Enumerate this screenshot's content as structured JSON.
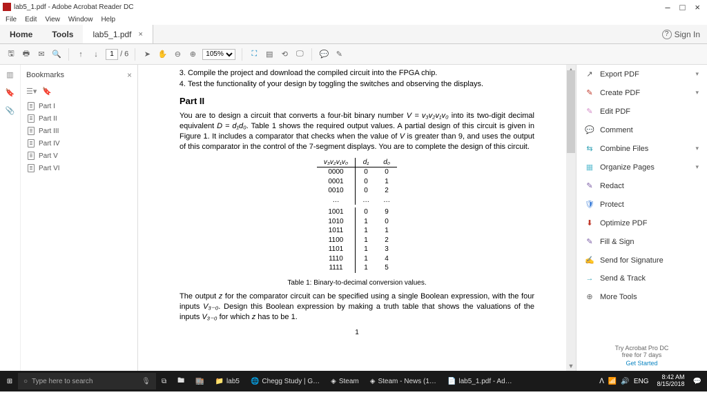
{
  "window": {
    "title": "lab5_1.pdf - Adobe Acrobat Reader DC",
    "min": "–",
    "max": "□",
    "close": "×"
  },
  "menu": [
    "File",
    "Edit",
    "View",
    "Window",
    "Help"
  ],
  "tabs": {
    "home": "Home",
    "tools": "Tools",
    "doc": "lab5_1.pdf",
    "signin": "Sign In",
    "help": "?"
  },
  "toolbar": {
    "page_cur": "1",
    "page_total": "/ 6",
    "zoom": "105%"
  },
  "bookmarks": {
    "title": "Bookmarks",
    "items": [
      "Part I",
      "Part II",
      "Part III",
      "Part IV",
      "Part V",
      "Part VI"
    ]
  },
  "doc": {
    "li3": "Compile the project and download the compiled circuit into the FPGA chip.",
    "li4": "Test the functionality of your design by toggling the switches and observing the displays.",
    "h": "Part II",
    "p1a": "You are to design a circuit that converts a four-bit binary number ",
    "p1b": " into its two-digit decimal equivalent ",
    "p1c": ". Table 1 shows the required output values. A partial design of this circuit is given in Figure 1. It includes a comparator that checks when the value of ",
    "p1d": " is greater than 9, and uses the output of this comparator in the control of the 7-segment displays. You are to complete the design of this circuit.",
    "th_v": "v₃v₂v₁v₀",
    "th_d1": "d₁",
    "th_d0": "d₀",
    "rows1": [
      [
        "0000",
        "0",
        "0"
      ],
      [
        "0001",
        "0",
        "1"
      ],
      [
        "0010",
        "0",
        "2"
      ],
      [
        "…",
        "…",
        "…"
      ]
    ],
    "rows2": [
      [
        "1001",
        "0",
        "9"
      ],
      [
        "1010",
        "1",
        "0"
      ],
      [
        "1011",
        "1",
        "1"
      ],
      [
        "1100",
        "1",
        "2"
      ],
      [
        "1101",
        "1",
        "3"
      ],
      [
        "1110",
        "1",
        "4"
      ],
      [
        "1111",
        "1",
        "5"
      ]
    ],
    "tcap": "Table 1: Binary-to-decimal conversion values.",
    "p2a": "The output ",
    "p2b": " for the comparator circuit can be specified using a single Boolean expression, with the four inputs ",
    "p2c": ". Design this Boolean expression by making a truth table that shows the valuations of the inputs ",
    "p2d": " for which ",
    "p2e": " has to be 1.",
    "pgno": "1"
  },
  "right": {
    "items": [
      {
        "icon": "↗",
        "label": "Export PDF",
        "color": "#555",
        "chev": true
      },
      {
        "icon": "✎",
        "label": "Create PDF",
        "color": "#c0392b",
        "chev": true
      },
      {
        "icon": "✎",
        "label": "Edit PDF",
        "color": "#d48bc8"
      },
      {
        "icon": "💬",
        "label": "Comment",
        "color": "#e8a33d"
      },
      {
        "icon": "⇆",
        "label": "Combine Files",
        "color": "#3aa6b9",
        "chev": true
      },
      {
        "icon": "▦",
        "label": "Organize Pages",
        "color": "#6cc3d5",
        "chev": true
      },
      {
        "icon": "✎",
        "label": "Redact",
        "color": "#7b5ca5"
      },
      {
        "icon": "🛡",
        "label": "Protect",
        "color": "#3b7dd8"
      },
      {
        "icon": "⬇",
        "label": "Optimize PDF",
        "color": "#c0392b"
      },
      {
        "icon": "✎",
        "label": "Fill & Sign",
        "color": "#7b5ca5"
      },
      {
        "icon": "✍",
        "label": "Send for Signature",
        "color": "#7b5ca5"
      },
      {
        "icon": "→",
        "label": "Send & Track",
        "color": "#3aa6b9"
      },
      {
        "icon": "⊕",
        "label": "More Tools",
        "color": "#666"
      }
    ],
    "trial1": "Try Acrobat Pro DC",
    "trial2": "free for 7 days",
    "trial3": "Get Started"
  },
  "taskbar": {
    "search": "Type here to search",
    "items": [
      "lab5",
      "Chegg Study | G…",
      "Steam",
      "Steam - News (1…",
      "lab5_1.pdf - Ad…"
    ],
    "time": "8:42 AM",
    "date": "8/15/2018",
    "lang": "ENG"
  }
}
